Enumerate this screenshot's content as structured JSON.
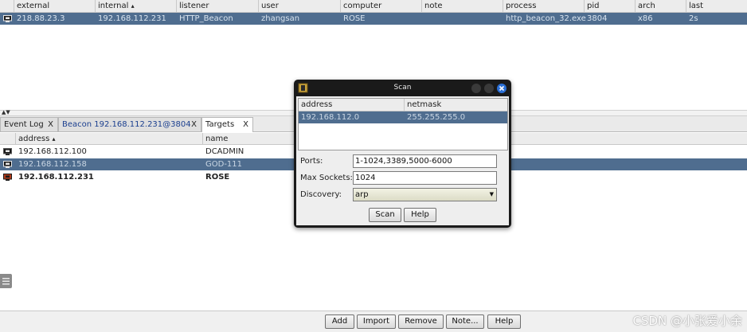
{
  "beacons_table": {
    "columns": [
      "external",
      "internal",
      "listener",
      "user",
      "computer",
      "note",
      "process",
      "pid",
      "arch",
      "last"
    ],
    "sorted_column_indicator": "▴",
    "rows": [
      {
        "external": "218.88.23.3",
        "internal": "192.168.112.231",
        "listener": "HTTP_Beacon",
        "user": "zhangsan",
        "computer": "ROSE",
        "note": "",
        "process": "http_beacon_32.exe",
        "pid": "3804",
        "arch": "x86",
        "last": "2s"
      }
    ]
  },
  "tabs": [
    {
      "label": "Event Log",
      "close": "X"
    },
    {
      "label": "Beacon 192.168.112.231@3804",
      "close": "X"
    },
    {
      "label": "Targets",
      "close": "X"
    }
  ],
  "targets_table": {
    "columns": [
      "address",
      "name"
    ],
    "sorted_column_indicator": "▴",
    "rows": [
      {
        "address": "192.168.112.100",
        "name": "DCADMIN"
      },
      {
        "address": "192.168.112.158",
        "name": "GOD-111"
      },
      {
        "address": "192.168.112.231",
        "name": "ROSE"
      }
    ]
  },
  "bottom_buttons": [
    "Add",
    "Import",
    "Remove",
    "Note...",
    "Help"
  ],
  "dialog": {
    "title": "Scan",
    "table_columns": [
      "address",
      "netmask"
    ],
    "table_rows": [
      {
        "address": "192.168.112.0",
        "netmask": "255.255.255.0"
      }
    ],
    "ports_label": "Ports:",
    "ports_value": "1-1024,3389,5000-6000",
    "max_sockets_label": "Max Sockets:",
    "max_sockets_value": "1024",
    "discovery_label": "Discovery:",
    "discovery_value": "arp",
    "scan_button": "Scan",
    "help_button": "Help"
  },
  "watermark": "CSDN @小张爱小余",
  "colors": {
    "selected_row": "#4f6d8f",
    "dialog_frame": "#1a1a1a",
    "close_button": "#2a6fd6",
    "host_icon_windows": "#1a1a1a",
    "host_icon_beacon": "#b03a1a"
  }
}
